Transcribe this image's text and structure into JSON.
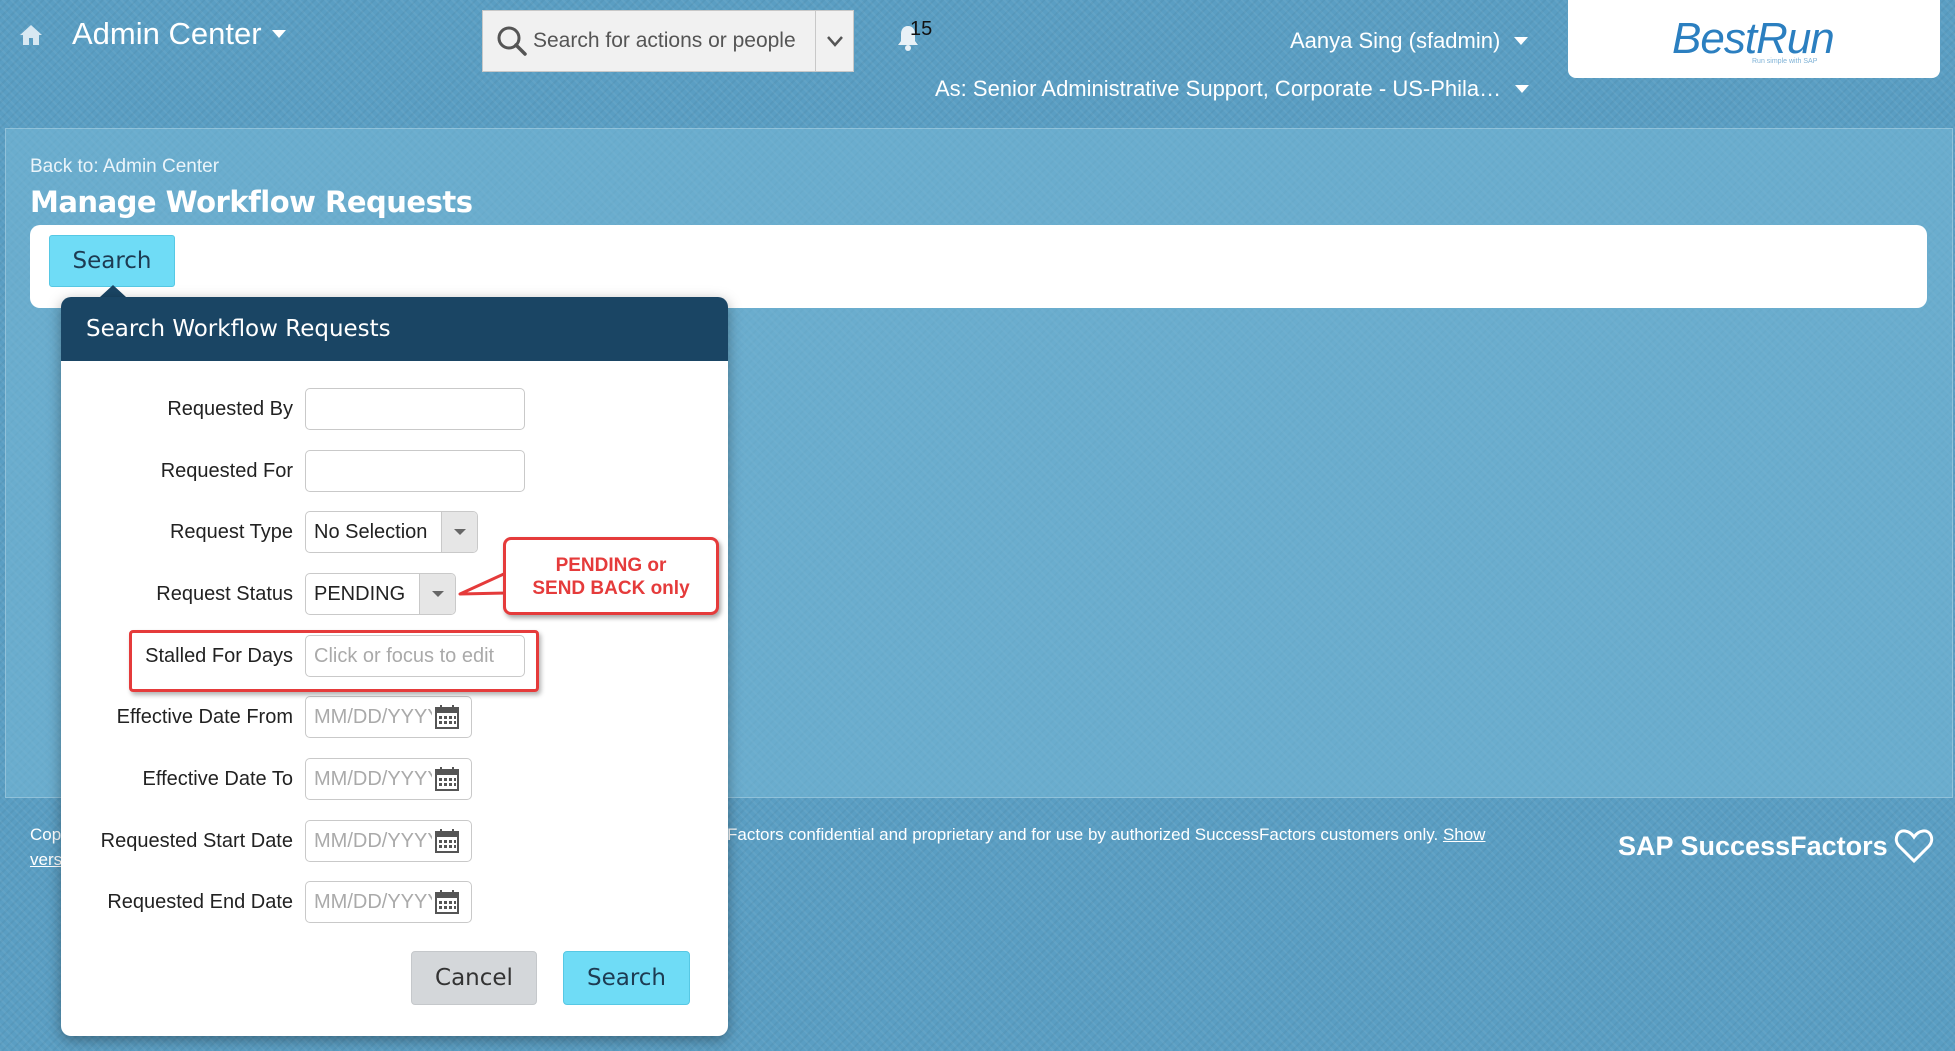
{
  "header": {
    "app_title": "Admin Center",
    "search_placeholder": "Search for actions or people",
    "notification_count": "15",
    "user_name": "Aanya Sing (sfadmin)",
    "proxy_as": "As: Senior Administrative Support, Corporate - US-Phila…",
    "logo_text": "BestRun",
    "logo_tagline": "Run simple with SAP"
  },
  "page": {
    "back_link": "Back to: Admin Center",
    "title": "Manage Workflow Requests",
    "toolbar_search_label": "Search"
  },
  "dialog": {
    "title": "Search Workflow Requests",
    "fields": {
      "requested_by": {
        "label": "Requested By",
        "value": ""
      },
      "requested_for": {
        "label": "Requested For",
        "value": ""
      },
      "request_type": {
        "label": "Request Type",
        "value": "No Selection"
      },
      "request_status": {
        "label": "Request Status",
        "value": "PENDING"
      },
      "stalled_for_days": {
        "label": "Stalled For Days",
        "placeholder": "Click or focus to edit"
      },
      "effective_date_from": {
        "label": "Effective Date From",
        "placeholder": "MM/DD/YYYY"
      },
      "effective_date_to": {
        "label": "Effective Date To",
        "placeholder": "MM/DD/YYYY"
      },
      "requested_start_date": {
        "label": "Requested Start Date",
        "placeholder": "MM/DD/YYYY"
      },
      "requested_end_date": {
        "label": "Requested End Date",
        "placeholder": "MM/DD/YYYY"
      }
    },
    "cancel_label": "Cancel",
    "search_label": "Search"
  },
  "annotation": {
    "callout_line1": "PENDING or",
    "callout_line2": "SEND BACK only"
  },
  "footer": {
    "left_line1": "Cop",
    "left_line2": "vers",
    "text": "Factors confidential and proprietary and for use by authorized SuccessFactors customers only.",
    "show_link": "Show",
    "brand": "SAP SuccessFactors"
  },
  "colors": {
    "background": "#5a9ec3",
    "dialog_header": "#1a4564",
    "primary_button": "#6fdcf6",
    "annotation_red": "#e53b3b",
    "logo_blue": "#2b7fc0"
  }
}
